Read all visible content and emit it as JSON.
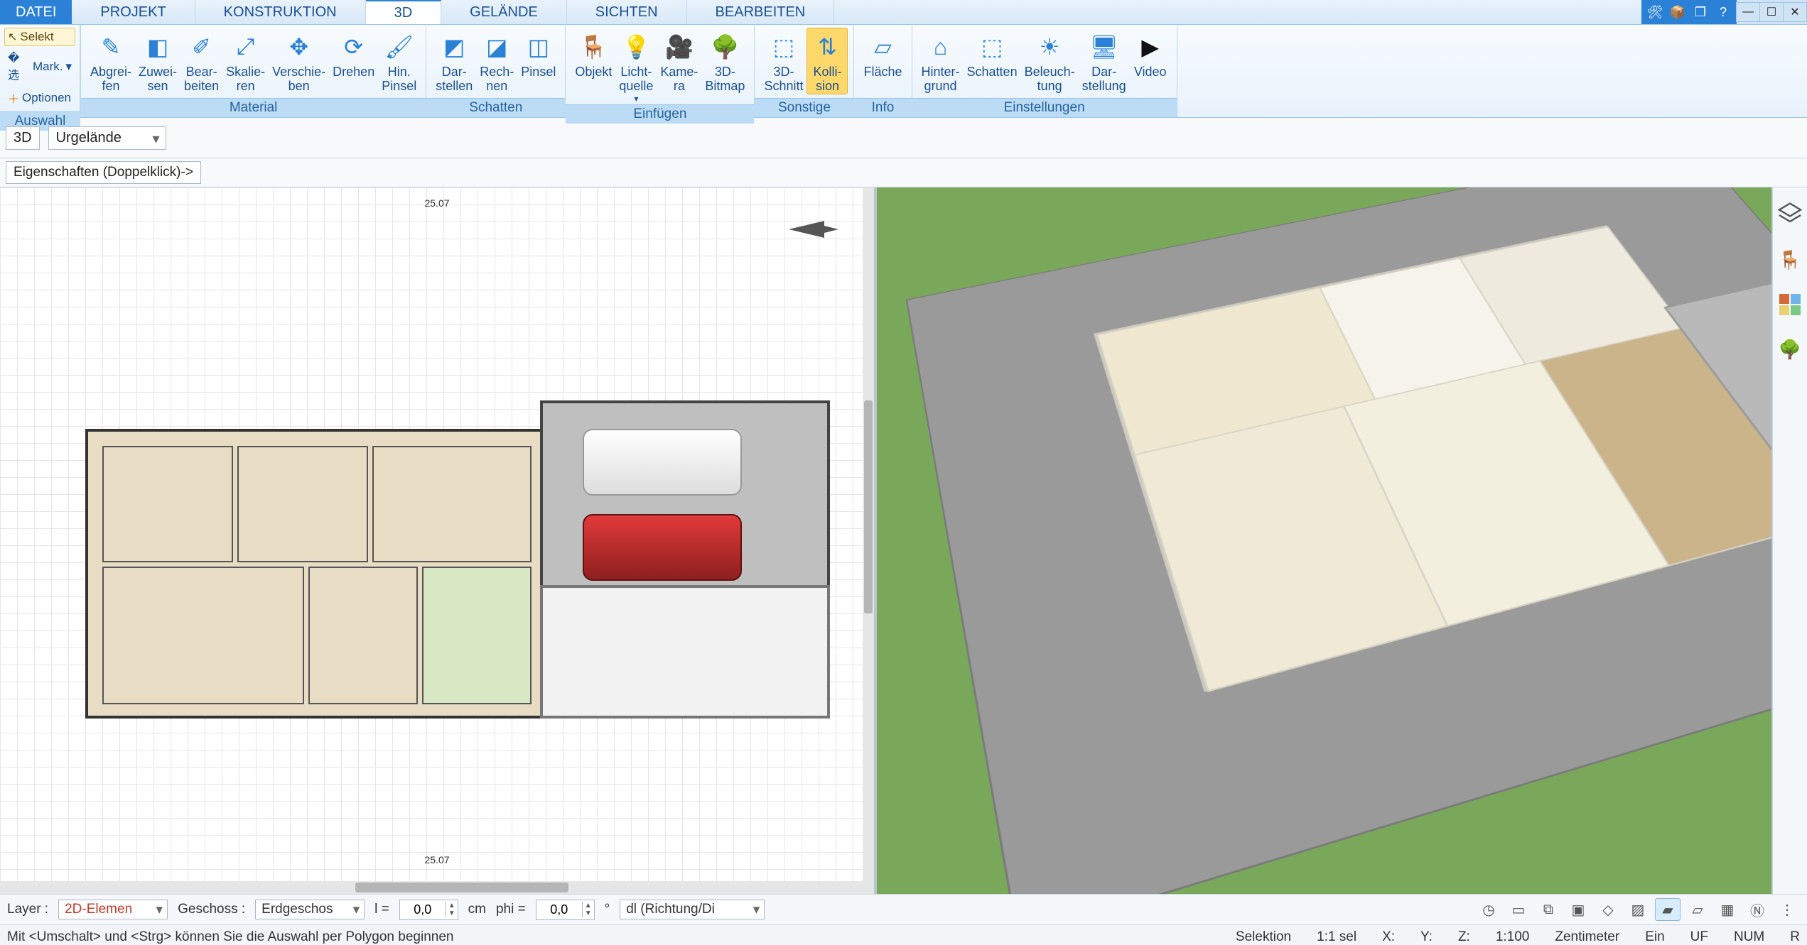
{
  "menu": {
    "file": "DATEI",
    "tabs": [
      "PROJEKT",
      "KONSTRUKTION",
      "3D",
      "GELÄNDE",
      "SICHTEN",
      "BEARBEITEN"
    ],
    "active_index": 2
  },
  "ribbon": {
    "groups": {
      "auswahl": {
        "caption": "Auswahl",
        "selekt": "Selekt",
        "mark": "Mark.",
        "optionen": "Optionen"
      },
      "material": {
        "caption": "Material",
        "items": [
          {
            "label": "Abgrei-\nfen"
          },
          {
            "label": "Zuwei-\nsen"
          },
          {
            "label": "Bear-\nbeiten"
          },
          {
            "label": "Skalie-\nren"
          },
          {
            "label": "Verschie-\nben"
          },
          {
            "label": "Drehen"
          },
          {
            "label": "Hin.\nPinsel"
          }
        ]
      },
      "schatten": {
        "caption": "Schatten",
        "items": [
          {
            "label": "Dar-\nstellen"
          },
          {
            "label": "Rech-\nnen"
          },
          {
            "label": "Pinsel"
          }
        ]
      },
      "einfuegen": {
        "caption": "Einfügen",
        "items": [
          {
            "label": "Objekt"
          },
          {
            "label": "Licht-\nquelle"
          },
          {
            "label": "Kame-\nra"
          },
          {
            "label": "3D-\nBitmap"
          }
        ]
      },
      "sonstige": {
        "caption": "Sonstige",
        "items": [
          {
            "label": "3D-\nSchnitt"
          },
          {
            "label": "Kolli-\nsion",
            "highlight": true
          }
        ]
      },
      "info": {
        "caption": "Info",
        "items": [
          {
            "label": "Fläche"
          }
        ]
      },
      "einstellungen": {
        "caption": "Einstellungen",
        "items": [
          {
            "label": "Hinter-\ngrund"
          },
          {
            "label": "Schatten"
          },
          {
            "label": "Beleuch-\ntung"
          },
          {
            "label": "Dar-\nstellung"
          },
          {
            "label": "Video"
          }
        ]
      }
    }
  },
  "subbar": {
    "mode": "3D",
    "terrain": "Urgelände"
  },
  "propsbar": {
    "hint": "Eigenschaften (Doppelklick)->"
  },
  "plan": {
    "dim_overall": "25.07"
  },
  "bottom": {
    "layer_label": "Layer :",
    "layer_value": "2D-Elemen",
    "geschoss_label": "Geschoss :",
    "geschoss_value": "Erdgeschos",
    "l_label": "l =",
    "l_value": "0,0",
    "l_unit": "cm",
    "phi_label": "phi =",
    "phi_value": "0,0",
    "phi_unit": "°",
    "dl_value": "dl (Richtung/Di"
  },
  "status": {
    "hint": "Mit <Umschalt> und <Strg> können Sie die Auswahl per Polygon beginnen",
    "selektion": "Selektion",
    "sel": "1:1 sel",
    "x": "X:",
    "y": "Y:",
    "z": "Z:",
    "scale": "1:100",
    "unit": "Zentimeter",
    "ein": "Ein",
    "uf": "UF",
    "num": "NUM",
    "r": "R"
  }
}
